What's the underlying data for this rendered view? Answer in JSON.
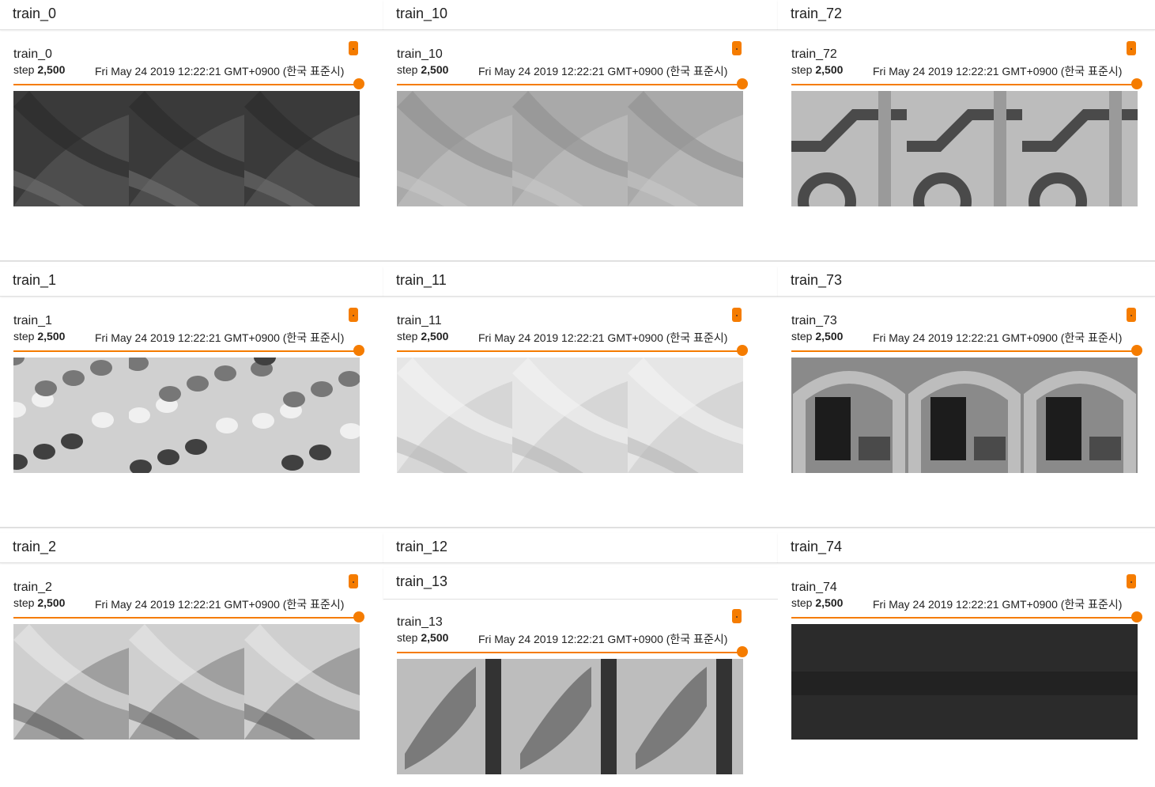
{
  "colors": {
    "accent": "#f57c00",
    "divider": "#e0e0e0"
  },
  "columns": [
    {
      "groups": [
        {
          "header": "train_0",
          "card": {
            "title": "train_0",
            "step_label": "step",
            "step_value": "2,500",
            "timestamp": "Fri May 24 2019 12:22:21 GMT+0900 (한국 표준시)",
            "tone": "dark"
          }
        },
        {
          "header": "train_1",
          "card": {
            "title": "train_1",
            "step_label": "step",
            "step_value": "2,500",
            "timestamp": "Fri May 24 2019 12:22:21 GMT+0900 (한국 표준시)",
            "tone": "mottled"
          }
        },
        {
          "header": "train_2",
          "card": {
            "title": "train_2",
            "step_label": "step",
            "step_value": "2,500",
            "timestamp": "Fri May 24 2019 12:22:21 GMT+0900 (한국 표준시)",
            "tone": "light"
          }
        }
      ]
    },
    {
      "groups": [
        {
          "header": "train_10",
          "card": {
            "title": "train_10",
            "step_label": "step",
            "step_value": "2,500",
            "timestamp": "Fri May 24 2019 12:22:21 GMT+0900 (한국 표준시)",
            "tone": "mid"
          }
        },
        {
          "header": "train_11",
          "card": {
            "title": "train_11",
            "step_label": "step",
            "step_value": "2,500",
            "timestamp": "Fri May 24 2019 12:22:21 GMT+0900 (한국 표준시)",
            "tone": "bright"
          }
        },
        {
          "header": "train_12",
          "subheader": "train_13",
          "card": {
            "title": "train_13",
            "step_label": "step",
            "step_value": "2,500",
            "timestamp": "Fri May 24 2019 12:22:21 GMT+0900 (한국 표준시)",
            "tone": "stripe"
          }
        }
      ]
    },
    {
      "groups": [
        {
          "header": "train_72",
          "card": {
            "title": "train_72",
            "step_label": "step",
            "step_value": "2,500",
            "timestamp": "Fri May 24 2019 12:22:21 GMT+0900 (한국 표준시)",
            "tone": "sign"
          }
        },
        {
          "header": "train_73",
          "card": {
            "title": "train_73",
            "step_label": "step",
            "step_value": "2,500",
            "timestamp": "Fri May 24 2019 12:22:21 GMT+0900 (한국 표준시)",
            "tone": "arch"
          }
        },
        {
          "header": "train_74",
          "card": {
            "title": "train_74",
            "step_label": "step",
            "step_value": "2,500",
            "timestamp": "Fri May 24 2019 12:22:21 GMT+0900 (한국 표준시)",
            "tone": "black"
          }
        }
      ]
    }
  ],
  "slider_position": 1.0
}
